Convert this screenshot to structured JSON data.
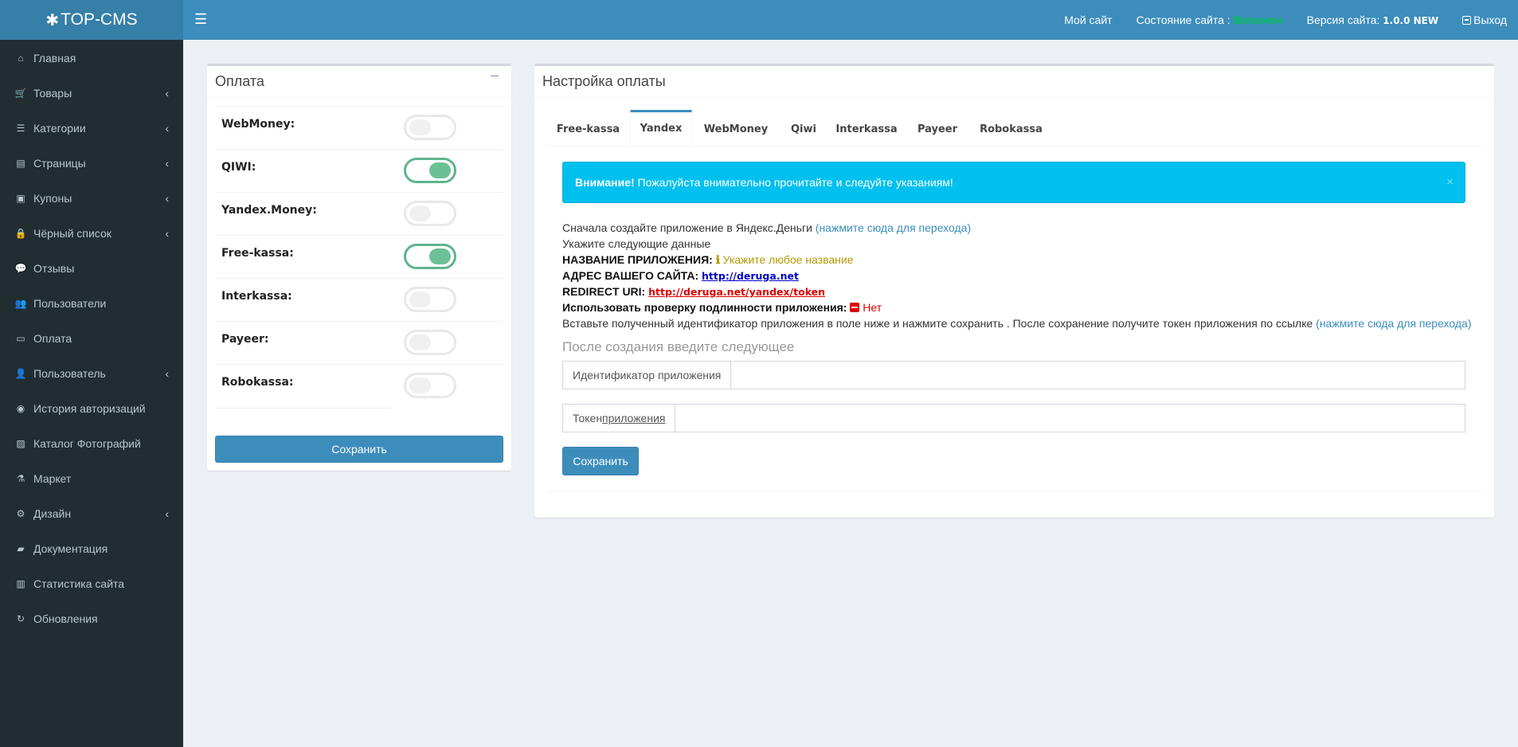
{
  "app": {
    "logo_text": "TOP-CMS",
    "logo_icon": "gear-icon"
  },
  "header": {
    "menu_toggle_icon": "hamburger-icon",
    "my_site": "Мой сайт",
    "status_label": "Состояние сайта :",
    "status_value": "Включен",
    "version_label": "Версия сайта:",
    "version_value": "1.0.0 NEW",
    "logout": "Выход"
  },
  "sidebar": {
    "items": [
      {
        "label": "Главная",
        "icon": "home-icon",
        "has_submenu": false
      },
      {
        "label": "Товары",
        "icon": "cart-icon",
        "has_submenu": true
      },
      {
        "label": "Категории",
        "icon": "list-icon",
        "has_submenu": true
      },
      {
        "label": "Страницы",
        "icon": "file-icon",
        "has_submenu": true
      },
      {
        "label": "Купоны",
        "icon": "gift-icon",
        "has_submenu": true
      },
      {
        "label": "Чёрный список",
        "icon": "lock-icon",
        "has_submenu": true
      },
      {
        "label": "Отзывы",
        "icon": "comments-icon",
        "has_submenu": false
      },
      {
        "label": "Пользователи",
        "icon": "users-icon",
        "has_submenu": false
      },
      {
        "label": "Оплата",
        "icon": "money-icon",
        "has_submenu": false
      },
      {
        "label": "Пользователь",
        "icon": "user-icon",
        "has_submenu": true
      },
      {
        "label": "История авторизаций",
        "icon": "eye-slash-icon",
        "has_submenu": false
      },
      {
        "label": "Каталог Фотографий",
        "icon": "image-icon",
        "has_submenu": false
      },
      {
        "label": "Маркет",
        "icon": "flask-icon",
        "has_submenu": false
      },
      {
        "label": "Дизайн",
        "icon": "cogs-icon",
        "has_submenu": true
      },
      {
        "label": "Документация",
        "icon": "book-icon",
        "has_submenu": false
      },
      {
        "label": "Статистика сайта",
        "icon": "bar-chart-icon",
        "has_submenu": false
      },
      {
        "label": "Обновления",
        "icon": "refresh-icon",
        "has_submenu": false
      }
    ]
  },
  "payment_box": {
    "title": "Оплата",
    "collapse_symbol": "−",
    "methods": [
      {
        "label": "WebMoney:",
        "enabled": false
      },
      {
        "label": "QIWI:",
        "enabled": true
      },
      {
        "label": "Yandex.Money:",
        "enabled": false
      },
      {
        "label": "Free-kassa:",
        "enabled": true
      },
      {
        "label": "Interkassa:",
        "enabled": false
      },
      {
        "label": "Payeer:",
        "enabled": false
      },
      {
        "label": "Robokassa:",
        "enabled": false
      }
    ],
    "save_label": "Сохранить"
  },
  "settings_box": {
    "title": "Настройка оплаты",
    "tabs": [
      {
        "label": "Free-kassa",
        "active": false
      },
      {
        "label": "Yandex",
        "active": true
      },
      {
        "label": "WebMoney",
        "active": false
      },
      {
        "label": "Qiwi",
        "active": false
      },
      {
        "label": "Interkassa",
        "active": false
      },
      {
        "label": "Payeer",
        "active": false
      },
      {
        "label": "Robokassa",
        "active": false
      }
    ],
    "alert": {
      "strong": "Внимание!",
      "text": " Пожалуйста внимательно прочитайте и следуйте указаниям!",
      "close": "×"
    },
    "instructions": {
      "line1_text": "Сначала создайте приложение в Яндекс.Деньги ",
      "line1_link": "(нажмите сюда для перехода)",
      "line2_text": "Укажите следующие данные",
      "app_name_label": "НАЗВАНИЕ ПРИЛОЖЕНИЯ:",
      "app_name_hint": "Укажите любое название",
      "site_label": "АДРЕС ВАШЕГО САЙТА:",
      "site_value": "http://deruga.net",
      "redirect_label": "REDIRECT URI:",
      "redirect_value": "http://deruga.net/yandex/token",
      "auth_check_label": "Использовать проверку подлинности приложения:",
      "auth_check_value": "Нет",
      "line7_text": "Вставьте полученный идентификатор приложения в поле ниже и нажмите сохранить . После сохранение получите токен приложения по ссылке ",
      "line7_link": "(нажмите сюда для перехода)"
    },
    "subtitle": "После создания введите следующее",
    "app_id_label": "Идентификатор приложения",
    "app_id_value": "",
    "token_label_prefix": "Токен ",
    "token_label_underlined": "приложения",
    "token_value": "",
    "save_label": "Сохранить"
  },
  "colors": {
    "header": "#3c8dbc",
    "logo_bg": "#367fa9",
    "sidebar": "#222d32",
    "alert": "#00c0ef",
    "toggle_on": "#6cc194",
    "status_on": "#00c050"
  }
}
